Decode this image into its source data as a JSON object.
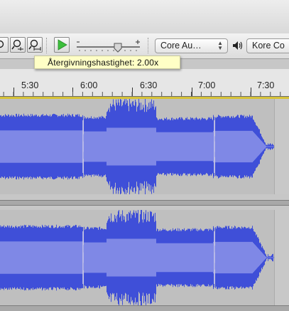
{
  "toolbar": {
    "device_combo": "Core Au…",
    "output_combo": "Kore Co",
    "icons": [
      "zoom-in-icon",
      "zoom-fit-icon",
      "play-at-speed-icon",
      "speed-slider",
      "speaker-icon"
    ]
  },
  "tooltip": {
    "text": "Återgivningshastighet: 2.00x"
  },
  "ruler": {
    "labels": [
      "5:30",
      "6:00",
      "6:30",
      "7:00",
      "7:30"
    ]
  },
  "colors": {
    "waveform": "#3f4fd8",
    "waveform_light": "#7f88e6",
    "track_bg": "#bfbfbf",
    "play_green": "#3cbf3c"
  }
}
